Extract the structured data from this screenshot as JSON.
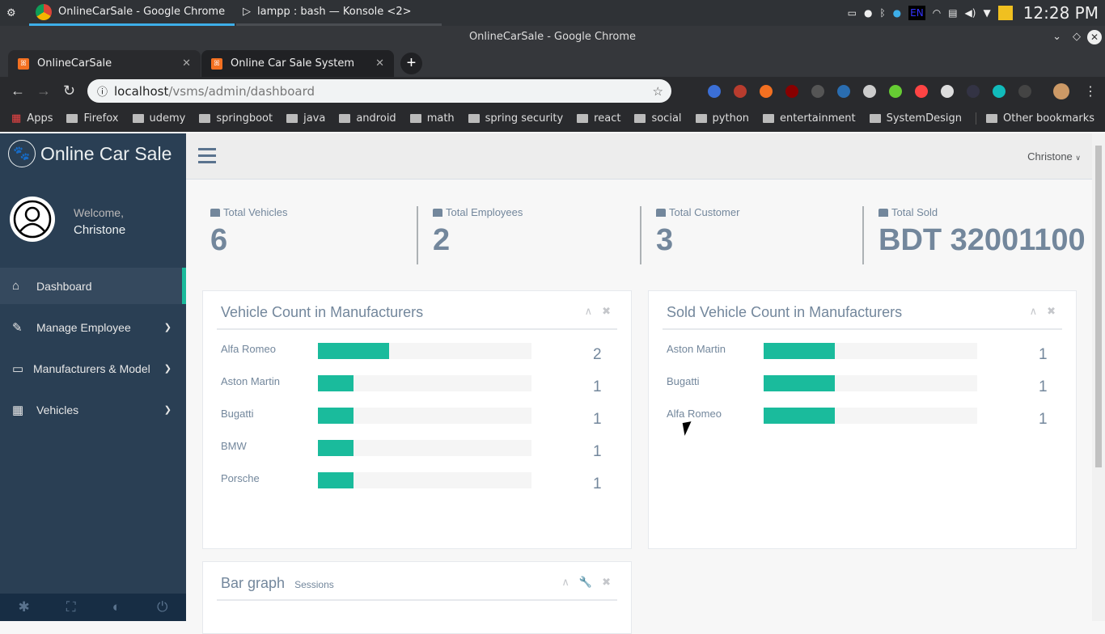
{
  "os": {
    "tasks": [
      "OnlineCarSale - Google Chrome",
      "lampp : bash — Konsole <2>"
    ],
    "tray_lang": "EN",
    "clock": "12:28 PM"
  },
  "browser": {
    "window_title": "OnlineCarSale - Google Chrome",
    "tabs": [
      {
        "label": "OnlineCarSale"
      },
      {
        "label": "Online Car Sale System"
      }
    ],
    "url_host": "localhost",
    "url_path": "/vsms/admin/dashboard",
    "bookmarks": [
      "Apps",
      "Firefox",
      "udemy",
      "springboot",
      "java",
      "android",
      "math",
      "spring security",
      "react",
      "social",
      "python",
      "entertainment",
      "SystemDesign"
    ],
    "other_bookmarks": "Other bookmarks"
  },
  "sidebar": {
    "brand": "Online Car Sale",
    "welcome": "Welcome,",
    "user": "Christone",
    "items": [
      {
        "label": "Dashboard"
      },
      {
        "label": "Manage Employee"
      },
      {
        "label": "Manufacturers & Model"
      },
      {
        "label": "Vehicles"
      }
    ]
  },
  "topnav": {
    "user": "Christone"
  },
  "tiles": [
    {
      "label": "Total Vehicles",
      "value": "6"
    },
    {
      "label": "Total Employees",
      "value": "2"
    },
    {
      "label": "Total Customer",
      "value": "3"
    },
    {
      "label": "Total Sold",
      "value": "BDT 32001100"
    }
  ],
  "vehicle_panel": {
    "title": "Vehicle Count in Manufacturers",
    "rows": [
      {
        "name": "Alfa Romeo",
        "count": "2",
        "fill_pct": 33.3
      },
      {
        "name": "Aston Martin",
        "count": "1",
        "fill_pct": 16.7
      },
      {
        "name": "Bugatti",
        "count": "1",
        "fill_pct": 16.7
      },
      {
        "name": "BMW",
        "count": "1",
        "fill_pct": 16.7
      },
      {
        "name": "Porsche",
        "count": "1",
        "fill_pct": 16.7
      }
    ]
  },
  "sold_panel": {
    "title": "Sold Vehicle Count in Manufacturers",
    "rows": [
      {
        "name": "Aston Martin",
        "count": "1",
        "fill_pct": 33.3
      },
      {
        "name": "Bugatti",
        "count": "1",
        "fill_pct": 33.3
      },
      {
        "name": "Alfa Romeo",
        "count": "1",
        "fill_pct": 33.3
      }
    ]
  },
  "bar_panel": {
    "title": "Bar graph",
    "subtitle": "Sessions"
  },
  "colors": {
    "accent": "#1ABB9C",
    "sidebar": "#2A3F54",
    "text": "#73879C"
  }
}
